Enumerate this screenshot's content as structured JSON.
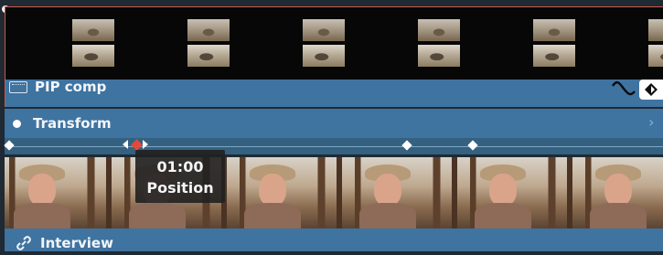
{
  "tracks": {
    "pip_clip": {
      "label": "PIP comp",
      "thumbnail_count": 6
    },
    "transform": {
      "label": "Transform"
    },
    "interview_clip": {
      "label": "Interview",
      "frame_count": 6
    }
  },
  "tooltip": {
    "time": "01:00",
    "property": "Position"
  },
  "icons": {
    "clip_type": "film-icon",
    "keyframe_curve": "curve-icon",
    "keyframe_toggle": "keyframe-diamond-icon",
    "parameter_dot": "dot-icon",
    "expand": "chevron-right-icon",
    "link": "link-icon"
  },
  "colors": {
    "track_blue": "#3f73a0",
    "selection_red": "#c95b4c",
    "active_keyframe": "#e2483b",
    "keyframe": "#ffffff"
  }
}
